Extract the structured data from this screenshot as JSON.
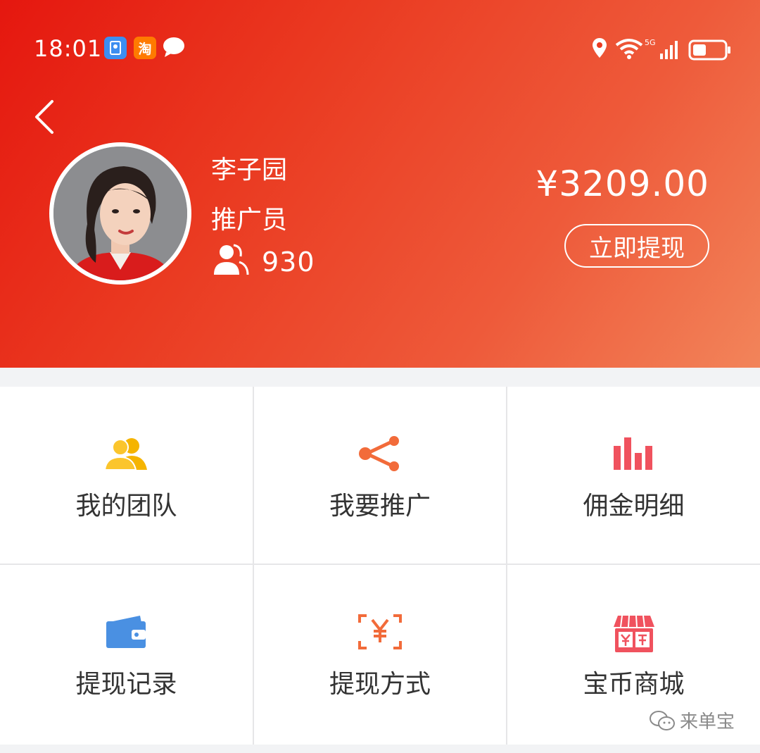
{
  "status_bar": {
    "time": "18:01",
    "network": "5G",
    "app_icon_taobao": "淘"
  },
  "profile": {
    "name": "李子园",
    "role": "推广员",
    "team_count": "930"
  },
  "wallet": {
    "balance": "¥3209.00",
    "withdraw_label": "立即提现"
  },
  "menu": [
    {
      "label": "我的团队",
      "icon": "team-icon",
      "color": "#f5b400"
    },
    {
      "label": "我要推广",
      "icon": "share-icon",
      "color": "#f26b3a"
    },
    {
      "label": "佣金明细",
      "icon": "bar-chart-icon",
      "color": "#f0525e"
    },
    {
      "label": "提现记录",
      "icon": "wallet-icon",
      "color": "#4a90e2"
    },
    {
      "label": "提现方式",
      "icon": "yuan-scan-icon",
      "color": "#f26b3a"
    },
    {
      "label": "宝币商城",
      "icon": "store-icon",
      "color": "#f0525e"
    }
  ],
  "watermark": "来单宝",
  "colors": {
    "header_start": "#e5170f",
    "header_end": "#f2845a"
  }
}
